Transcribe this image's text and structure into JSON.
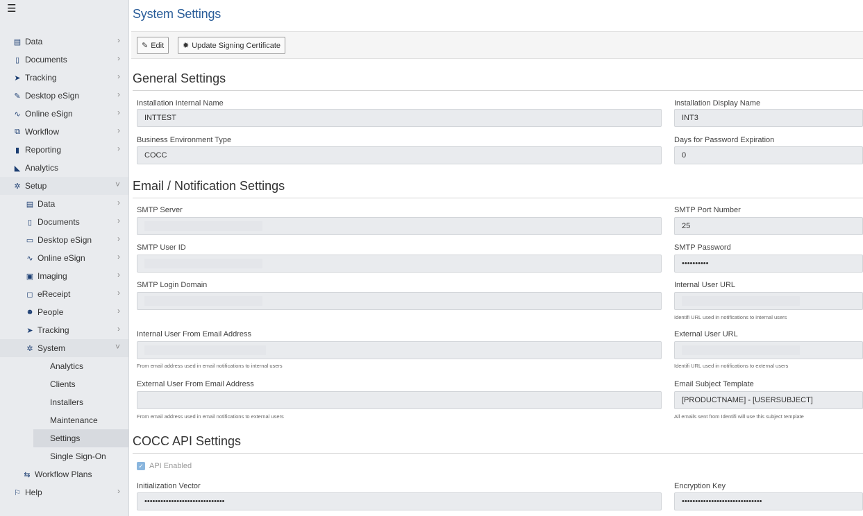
{
  "sidebar": {
    "menu_icon": "☰",
    "items": [
      {
        "label": "Data",
        "icon": "database-icon"
      },
      {
        "label": "Documents",
        "icon": "clipboard-icon"
      },
      {
        "label": "Tracking",
        "icon": "paper-plane-icon"
      },
      {
        "label": "Desktop eSign",
        "icon": "pen-icon"
      },
      {
        "label": "Online eSign",
        "icon": "signature-icon"
      },
      {
        "label": "Workflow",
        "icon": "sitemap-icon"
      },
      {
        "label": "Reporting",
        "icon": "file-icon"
      },
      {
        "label": "Analytics",
        "icon": "area-chart-icon"
      },
      {
        "label": "Setup",
        "icon": "gear-icon"
      }
    ],
    "setup_items": [
      {
        "label": "Data",
        "icon": "database-icon"
      },
      {
        "label": "Documents",
        "icon": "clipboard-icon"
      },
      {
        "label": "Desktop eSign",
        "icon": "desktop-icon"
      },
      {
        "label": "Online eSign",
        "icon": "signature-icon"
      },
      {
        "label": "Imaging",
        "icon": "image-icon"
      },
      {
        "label": "eReceipt",
        "icon": "receipt-icon"
      },
      {
        "label": "People",
        "icon": "users-icon"
      },
      {
        "label": "Tracking",
        "icon": "paper-plane-icon"
      },
      {
        "label": "System",
        "icon": "cogs-icon"
      }
    ],
    "system_items": [
      {
        "label": "Analytics"
      },
      {
        "label": "Clients"
      },
      {
        "label": "Installers"
      },
      {
        "label": "Maintenance"
      },
      {
        "label": "Settings"
      },
      {
        "label": "Single Sign-On"
      }
    ],
    "workflow_plans": "Workflow Plans",
    "help": "Help"
  },
  "page": {
    "title": "System Settings"
  },
  "toolbar": {
    "edit_label": "Edit",
    "update_cert_label": "Update Signing Certificate"
  },
  "general": {
    "title": "General Settings",
    "internal_name_label": "Installation Internal Name",
    "internal_name_value": "INTTEST",
    "display_name_label": "Installation Display Name",
    "display_name_value": "INT3",
    "biz_env_label": "Business Environment Type",
    "biz_env_value": "COCC",
    "pwd_exp_label": "Days for Password Expiration",
    "pwd_exp_value": "0"
  },
  "email": {
    "title": "Email / Notification Settings",
    "smtp_server_label": "SMTP Server",
    "smtp_port_label": "SMTP Port Number",
    "smtp_port_value": "25",
    "smtp_user_label": "SMTP User ID",
    "smtp_password_label": "SMTP Password",
    "smtp_password_value": "••••••••••",
    "smtp_domain_label": "SMTP Login Domain",
    "internal_url_label": "Internal User URL",
    "internal_url_help": "Identifi URL used in notifications to internal users",
    "internal_from_label": "Internal User From Email Address",
    "internal_from_help": "From email address used in email notifications to internal users",
    "external_url_label": "External User URL",
    "external_url_help": "Identifi URL used in notifications to external users",
    "external_from_label": "External User From Email Address",
    "external_from_help": "From email address used in email notifications to external users",
    "subject_label": "Email Subject Template",
    "subject_value": "[PRODUCTNAME] - [USERSUBJECT]",
    "subject_help": "All emails sent from Identifi will use this subject template"
  },
  "cocc": {
    "title": "COCC API Settings",
    "api_enabled_label": "API Enabled",
    "iv_label": "Initialization Vector",
    "iv_value": "••••••••••••••••••••••••••••••",
    "key_label": "Encryption Key",
    "key_value": "••••••••••••••••••••••••••••••"
  },
  "colors": {
    "accent": "#2a5d99",
    "sidebar_bg": "#e9ebee",
    "field_bg": "#e9ebee",
    "icon": "#1c3e72"
  }
}
